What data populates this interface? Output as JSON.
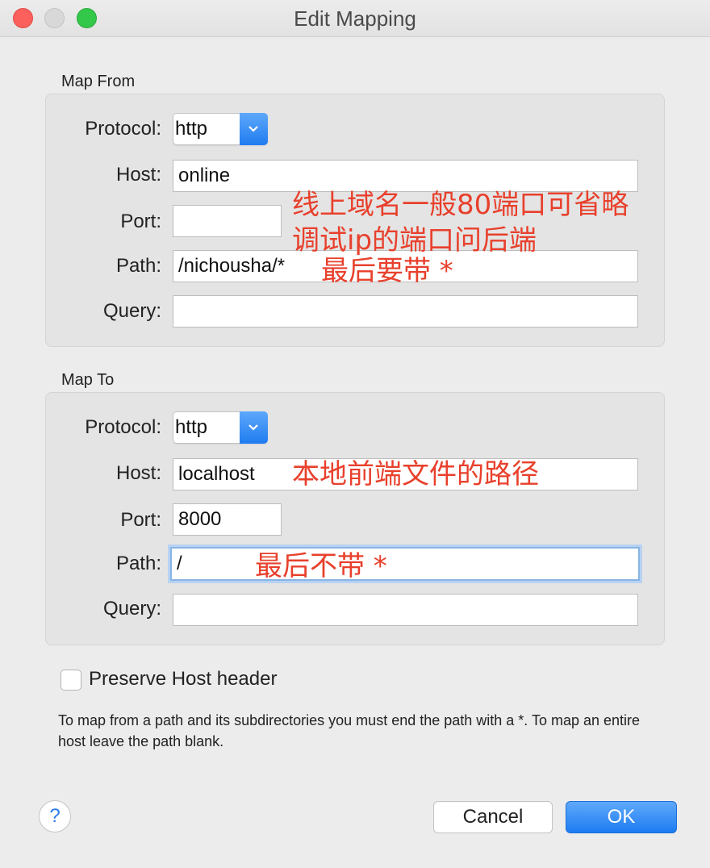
{
  "window": {
    "title": "Edit Mapping"
  },
  "map_from": {
    "label": "Map From",
    "protocol_label": "Protocol:",
    "protocol_value": "http",
    "host_label": "Host:",
    "host_value": "online",
    "port_label": "Port:",
    "port_value": "",
    "path_label": "Path:",
    "path_value": "/nichousha/*",
    "query_label": "Query:",
    "query_value": ""
  },
  "map_to": {
    "label": "Map To",
    "protocol_label": "Protocol:",
    "protocol_value": "http",
    "host_label": "Host:",
    "host_value": "localhost",
    "port_label": "Port:",
    "port_value": "8000",
    "path_label": "Path:",
    "path_value": "/",
    "query_label": "Query:",
    "query_value": ""
  },
  "annotations": {
    "from_host_note_1": "线上域名一般80端口可省略",
    "from_host_note_2": "调试ip的端口问后端",
    "from_path_note": "最后要带 *",
    "to_host_note": "本地前端文件的路径",
    "to_path_note": "最后不带 *"
  },
  "preserve_host": {
    "label": "Preserve Host header",
    "checked": false
  },
  "help_text": "To map from a path and its subdirectories you must end the path with a *. To map an entire host leave the path blank.",
  "buttons": {
    "help": "?",
    "cancel": "Cancel",
    "ok": "OK"
  },
  "colors": {
    "accent": "#1f7cf0",
    "annotation": "#e8402c",
    "close": "#fc605c",
    "zoom": "#34c84a"
  }
}
